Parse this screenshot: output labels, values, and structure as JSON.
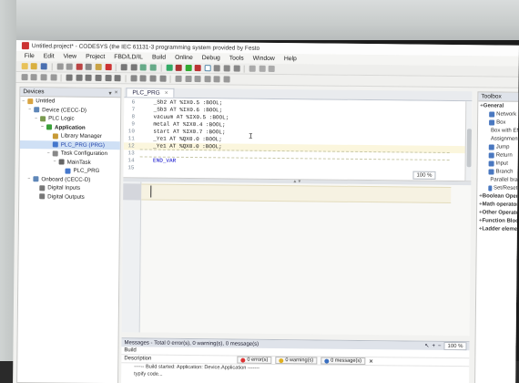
{
  "window": {
    "title": "Untitled.project* - CODESYS (the IEC 61131-3 programming system provided by Festo"
  },
  "menu": [
    "File",
    "Edit",
    "View",
    "Project",
    "FBD/LD/IL",
    "Build",
    "Online",
    "Debug",
    "Tools",
    "Window",
    "Help"
  ],
  "devices_panel": {
    "title": "Devices",
    "tree": [
      {
        "label": "Untitled",
        "level": 0,
        "icon": "project-icon",
        "color": "#d9a441",
        "expander": "−"
      },
      {
        "label": "Device (CECC-D)",
        "level": 1,
        "icon": "device-icon",
        "color": "#5f87b8",
        "expander": "−"
      },
      {
        "label": "PLC Logic",
        "level": 2,
        "icon": "plc-logic-icon",
        "color": "#7a9a4f",
        "expander": "−"
      },
      {
        "label": "Application",
        "level": 3,
        "icon": "application-icon",
        "color": "#3aa03a",
        "expander": "−",
        "bold": true
      },
      {
        "label": "Library Manager",
        "level": 4,
        "icon": "library-icon",
        "color": "#c79a35"
      },
      {
        "label": "PLC_PRG (PRG)",
        "level": 4,
        "icon": "program-icon",
        "color": "#4477cc",
        "selected": true
      },
      {
        "label": "Task Configuration",
        "level": 4,
        "icon": "task-config-icon",
        "color": "#888888",
        "expander": "−"
      },
      {
        "label": "MainTask",
        "level": 5,
        "icon": "task-icon",
        "color": "#666666",
        "expander": "−"
      },
      {
        "label": "PLC_PRG",
        "level": 6,
        "icon": "program-call-icon",
        "color": "#4477cc"
      },
      {
        "label": "Onboard (CECC-D)",
        "level": 1,
        "icon": "onboard-icon",
        "color": "#5f87b8",
        "expander": "−"
      },
      {
        "label": "Digital Inputs",
        "level": 2,
        "icon": "io-icon",
        "color": "#777777"
      },
      {
        "label": "Digital Outputs",
        "level": 2,
        "icon": "io-icon",
        "color": "#777777"
      }
    ]
  },
  "editor": {
    "tab_label": "PLC_PRG",
    "declaration_lines": [
      {
        "n": "6",
        "text": "    _Sb2 AT %IX0.5 :BOOL;"
      },
      {
        "n": "7",
        "text": "    _Sb3 AT %IX0.6 :BOOL;"
      },
      {
        "n": "8",
        "text": "    vacuum AT %IX0.5 :BOOL;"
      },
      {
        "n": "9",
        "text": "    metal AT %IX0.4 :BOOL;"
      },
      {
        "n": "10",
        "text": "    start AT %IX0.7 :BOOL;"
      },
      {
        "n": "11",
        "text": "    _Ye1 AT %QX0.0 :BOOL;"
      },
      {
        "n": "12",
        "text": "    _Ye1 AT %QX0.0 :BOOL;"
      },
      {
        "n": "13",
        "text": ""
      },
      {
        "n": "14",
        "text": "    END_VAR"
      },
      {
        "n": "15",
        "text": ""
      }
    ],
    "declaration_zoom": "100 %",
    "impl_zoom": "100 %",
    "splitter_glyph": "▲▼"
  },
  "messages": {
    "header": "Messages - Total 0 error(s), 0 warning(s), 0 message(s)",
    "source_label": "Build",
    "description_label": "Description",
    "errors": "0 error(s)",
    "warnings": "0 warning(s)",
    "msgs": "0 message(s)",
    "lines": [
      "------ Build started: Application: Device.Application -------",
      "typify code..."
    ]
  },
  "toolbox": {
    "title": "Toolbox",
    "items": [
      {
        "type": "cat",
        "label": "General"
      },
      {
        "type": "item",
        "label": "Network",
        "color": "#4a78c0"
      },
      {
        "type": "item",
        "label": "Box",
        "color": "#4a78c0"
      },
      {
        "type": "item",
        "label": "Box with EN/ENO",
        "color": "#4a78c0"
      },
      {
        "type": "item",
        "label": "Assignment",
        "color": "#4a78c0"
      },
      {
        "type": "item",
        "label": "Jump",
        "color": "#4a78c0"
      },
      {
        "type": "item",
        "label": "Return",
        "color": "#4a78c0"
      },
      {
        "type": "item",
        "label": "Input",
        "color": "#4a78c0"
      },
      {
        "type": "item",
        "label": "Branch",
        "color": "#4a78c0"
      },
      {
        "type": "item",
        "label": "Parallel branch",
        "color": "#4a78c0"
      },
      {
        "type": "item",
        "label": "Set/Reset",
        "color": "#4a78c0"
      },
      {
        "type": "cat",
        "label": "Boolean Operators"
      },
      {
        "type": "cat",
        "label": "Math operators"
      },
      {
        "type": "cat",
        "label": "Other Operators"
      },
      {
        "type": "cat",
        "label": "Function Blocks"
      },
      {
        "type": "cat",
        "label": "Ladder elements"
      }
    ]
  }
}
